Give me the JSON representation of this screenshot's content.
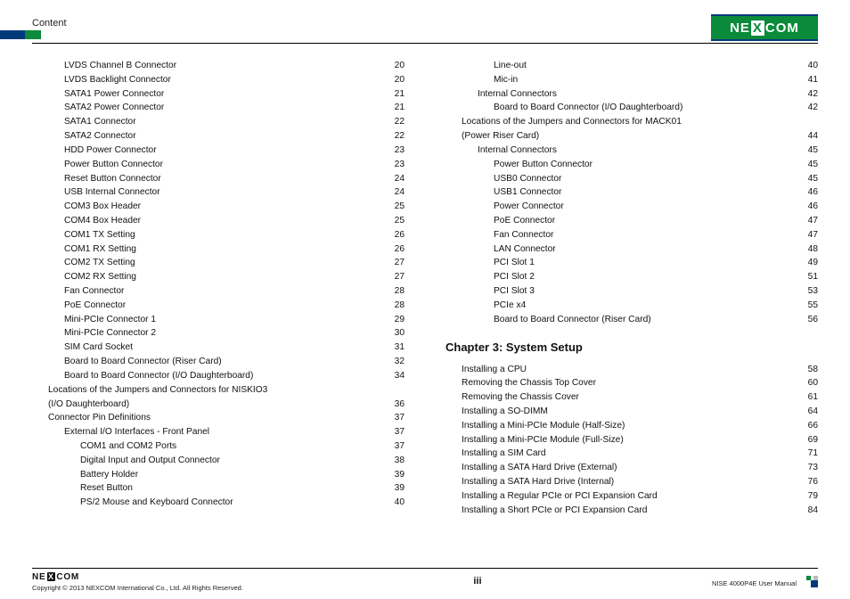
{
  "header": {
    "section": "Content"
  },
  "logo": {
    "text_left": "NE",
    "text_x": "X",
    "text_right": "COM"
  },
  "left_column": [
    {
      "indent": 2,
      "label": "LVDS Channel B Connector",
      "page": "20"
    },
    {
      "indent": 2,
      "label": "LVDS Backlight Connector",
      "page": "20"
    },
    {
      "indent": 2,
      "label": "SATA1 Power Connector",
      "page": "21"
    },
    {
      "indent": 2,
      "label": "SATA2 Power Connector",
      "page": "21"
    },
    {
      "indent": 2,
      "label": "SATA1 Connector",
      "page": "22"
    },
    {
      "indent": 2,
      "label": "SATA2 Connector",
      "page": "22"
    },
    {
      "indent": 2,
      "label": "HDD Power Connector",
      "page": "23"
    },
    {
      "indent": 2,
      "label": "Power Button Connector",
      "page": "23"
    },
    {
      "indent": 2,
      "label": "Reset Button Connector",
      "page": "24"
    },
    {
      "indent": 2,
      "label": "USB Internal Connector",
      "page": "24"
    },
    {
      "indent": 2,
      "label": "COM3 Box Header",
      "page": "25"
    },
    {
      "indent": 2,
      "label": "COM4 Box Header",
      "page": "25"
    },
    {
      "indent": 2,
      "label": "COM1 TX Setting",
      "page": "26"
    },
    {
      "indent": 2,
      "label": "COM1 RX Setting",
      "page": "26"
    },
    {
      "indent": 2,
      "label": "COM2 TX Setting",
      "page": "27"
    },
    {
      "indent": 2,
      "label": "COM2 RX Setting",
      "page": "27"
    },
    {
      "indent": 2,
      "label": "Fan Connector",
      "page": "28"
    },
    {
      "indent": 2,
      "label": "PoE Connector",
      "page": "28"
    },
    {
      "indent": 2,
      "label": "Mini-PCIe Connector 1",
      "page": "29"
    },
    {
      "indent": 2,
      "label": "Mini-PCIe Connector 2",
      "page": "30"
    },
    {
      "indent": 2,
      "label": "SIM Card Socket",
      "page": "31"
    },
    {
      "indent": 2,
      "label": "Board to Board Connector (Riser Card)",
      "page": "32"
    },
    {
      "indent": 2,
      "label": "Board to Board Connector (I/O Daughterboard)",
      "page": "34"
    },
    {
      "indent": 1,
      "label": "Locations of the Jumpers and Connectors for NISKIO3",
      "page": "",
      "nodots": true
    },
    {
      "indent": 1,
      "label": "(I/O Daughterboard)",
      "page": "36",
      "cont": true
    },
    {
      "indent": 1,
      "label": "Connector Pin Definitions",
      "page": "37"
    },
    {
      "indent": 2,
      "label": "External I/O Interfaces - Front Panel",
      "page": "37"
    },
    {
      "indent": 3,
      "label": "COM1 and COM2 Ports",
      "page": "37"
    },
    {
      "indent": 3,
      "label": "Digital Input and Output Connector",
      "page": "38"
    },
    {
      "indent": 3,
      "label": "Battery Holder",
      "page": "39"
    },
    {
      "indent": 3,
      "label": "Reset Button",
      "page": "39"
    },
    {
      "indent": 3,
      "label": "PS/2 Mouse and Keyboard Connector",
      "page": "40"
    }
  ],
  "right_column_top": [
    {
      "indent": 3,
      "label": "Line-out",
      "page": "40"
    },
    {
      "indent": 3,
      "label": "Mic-in",
      "page": "41"
    },
    {
      "indent": 2,
      "label": "Internal Connectors",
      "page": "42"
    },
    {
      "indent": 3,
      "label": "Board to Board Connector (I/O Daughterboard)",
      "page": "42"
    },
    {
      "indent": 1,
      "label": "Locations of the Jumpers and Connectors for MACK01",
      "page": "",
      "nodots": true
    },
    {
      "indent": 1,
      "label": "(Power Riser Card)",
      "page": "44",
      "cont": true
    },
    {
      "indent": 2,
      "label": "Internal Connectors",
      "page": "45"
    },
    {
      "indent": 3,
      "label": "Power Button Connector",
      "page": "45"
    },
    {
      "indent": 3,
      "label": "USB0 Connector",
      "page": "45"
    },
    {
      "indent": 3,
      "label": "USB1 Connector",
      "page": "46"
    },
    {
      "indent": 3,
      "label": "Power Connector",
      "page": "46"
    },
    {
      "indent": 3,
      "label": "PoE Connector",
      "page": "47"
    },
    {
      "indent": 3,
      "label": "Fan Connector",
      "page": "47"
    },
    {
      "indent": 3,
      "label": "LAN Connector",
      "page": "48"
    },
    {
      "indent": 3,
      "label": "PCI Slot 1",
      "page": "49"
    },
    {
      "indent": 3,
      "label": "PCI Slot 2",
      "page": "51"
    },
    {
      "indent": 3,
      "label": "PCI Slot 3",
      "page": "53"
    },
    {
      "indent": 3,
      "label": "PCIe x4",
      "page": "55"
    },
    {
      "indent": 3,
      "label": "Board to Board Connector (Riser Card)",
      "page": "56"
    }
  ],
  "chapter3_title": "Chapter 3: System Setup",
  "right_column_ch3": [
    {
      "indent": 1,
      "label": "Installing a CPU",
      "page": "58"
    },
    {
      "indent": 1,
      "label": "Removing the Chassis Top Cover",
      "page": "60"
    },
    {
      "indent": 1,
      "label": "Removing the Chassis Cover",
      "page": "61"
    },
    {
      "indent": 1,
      "label": "Installing a SO-DIMM",
      "page": "64"
    },
    {
      "indent": 1,
      "label": "Installing a Mini-PCIe Module (Half-Size)",
      "page": "66"
    },
    {
      "indent": 1,
      "label": "Installing a Mini-PCIe Module (Full-Size)",
      "page": "69"
    },
    {
      "indent": 1,
      "label": "Installing a SIM Card",
      "page": "71"
    },
    {
      "indent": 1,
      "label": "Installing a SATA Hard Drive (External)",
      "page": "73"
    },
    {
      "indent": 1,
      "label": "Installing a SATA Hard Drive (Internal)",
      "page": "76"
    },
    {
      "indent": 1,
      "label": "Installing a Regular PCIe or PCI Expansion Card",
      "page": "79"
    },
    {
      "indent": 1,
      "label": "Installing a Short PCIe or PCI Expansion Card",
      "page": "84"
    }
  ],
  "footer": {
    "copyright": "Copyright © 2013 NEXCOM International Co., Ltd. All Rights Reserved.",
    "page_number": "iii",
    "doc_title": "NISE 4000P4E User Manual"
  }
}
